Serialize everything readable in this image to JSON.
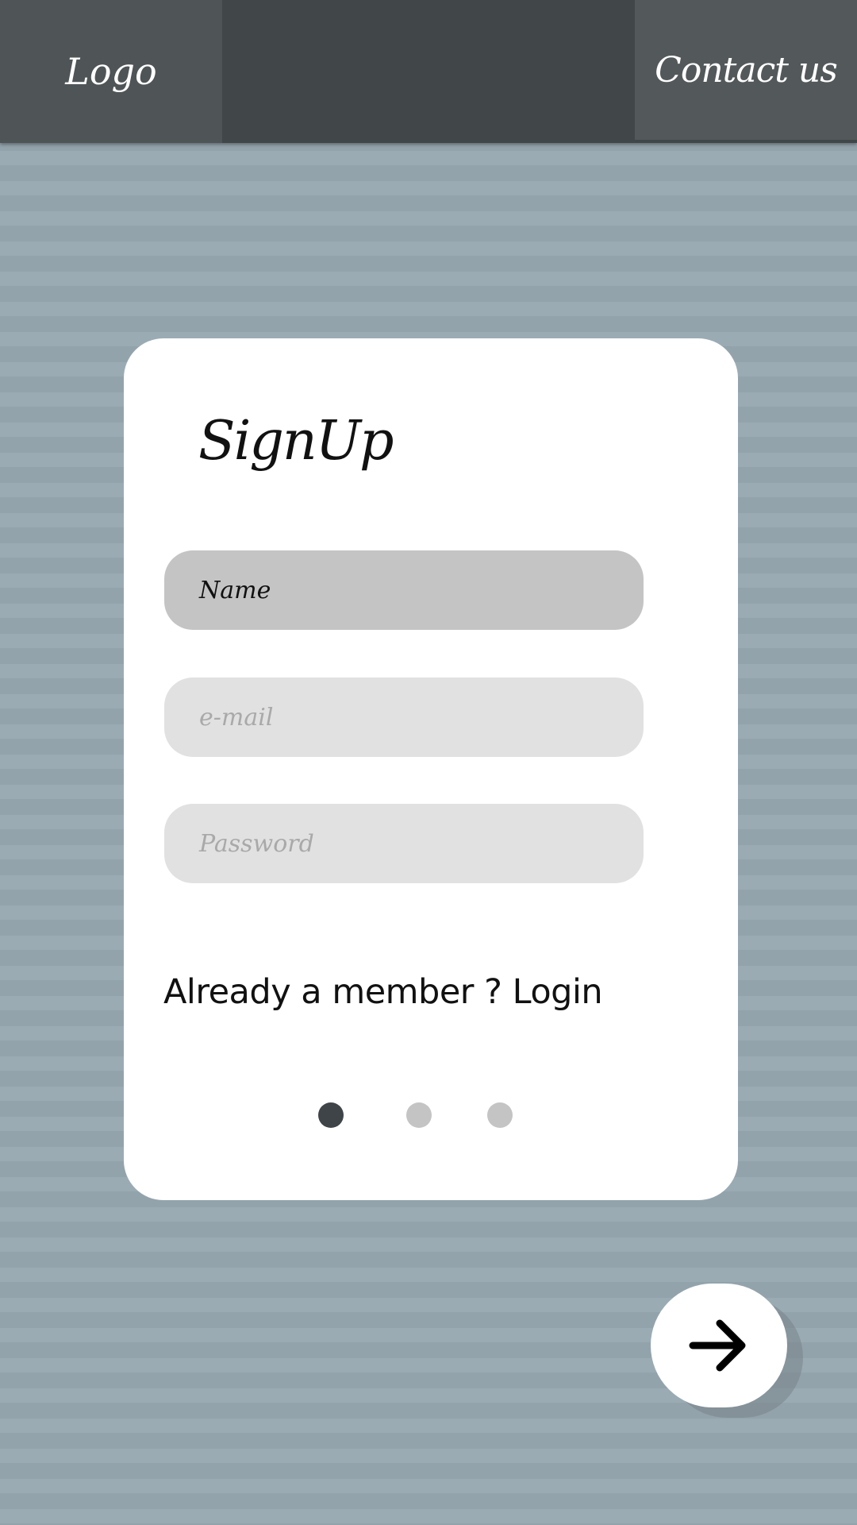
{
  "header": {
    "logo_label": "Logo",
    "contact_label": "Contact us"
  },
  "card": {
    "title": "SignUp",
    "fields": {
      "name_placeholder": "Name",
      "email_placeholder": "e-mail",
      "password_placeholder": "Password"
    },
    "login_prompt": "Already a member ? Login",
    "pager": {
      "active_index": 0,
      "count": 3
    }
  },
  "next_button": {
    "icon": "arrow-right-icon"
  },
  "colors": {
    "header_center": "#414649",
    "header_left": "#4f5457",
    "header_right": "#53585b",
    "background": "#95a5ae",
    "card": "#ffffff",
    "field_active": "#c4c4c4",
    "field_inactive": "#e1e1e1",
    "dot_active": "#3f4448",
    "dot_inactive": "#c4c4c4"
  }
}
